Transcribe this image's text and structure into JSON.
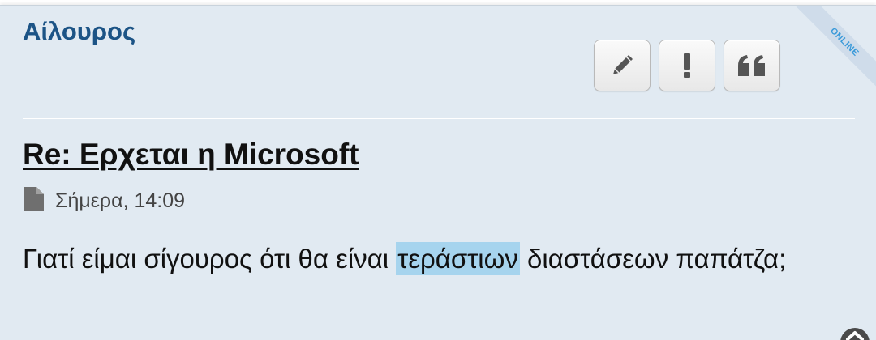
{
  "post": {
    "author": "Αίλουρος",
    "status_badge": "ONLINE",
    "title": "Re: Ερχεται η Microsoft",
    "date": "Σήμερα, 14:09",
    "body": {
      "before": "Γιατί είμαι σίγουρος ότι θα είναι ",
      "highlighted": "τεράστιων",
      "after": " διαστάσεων παπάτζα;"
    }
  },
  "actions": {
    "edit_icon": "pencil-icon",
    "report_icon": "exclamation-icon",
    "quote_icon": "quote-icon"
  },
  "colors": {
    "background": "#e1eaf2",
    "author": "#1c5486",
    "highlight": "#a6d4ee",
    "badge": "#3a9ad9"
  }
}
